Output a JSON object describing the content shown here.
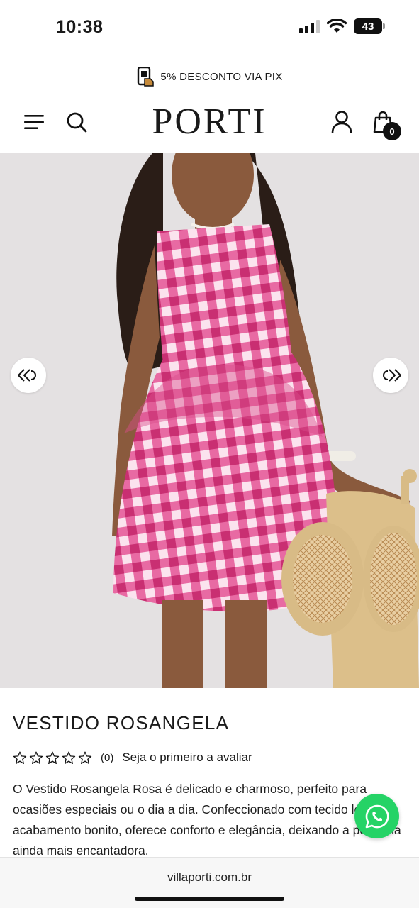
{
  "status_bar": {
    "time": "10:38",
    "battery": "43"
  },
  "promo": {
    "text": "5% DESCONTO VIA PIX",
    "icon": "pix-phone-icon"
  },
  "header": {
    "logo": "PORTI",
    "cart_count": "0"
  },
  "product": {
    "title": "VESTIDO ROSANGELA",
    "rating_count": "(0)",
    "review_prompt": "Seja o primeiro a avaliar",
    "description": "O Vestido Rosangela Rosa é delicado e charmoso, perfeito para ocasiões especiais ou o dia a dia. Confeccionado com tecido leve e acabamento bonito, oferece conforto e elegância, deixando a pequena ainda mais encantadora.",
    "image_alt_colors": {
      "dress": "#d6387b",
      "background": "#e6e3e3"
    }
  },
  "browser": {
    "url": "villaporti.com.br"
  },
  "colors": {
    "whatsapp": "#25D366",
    "text": "#1a1a1a"
  }
}
